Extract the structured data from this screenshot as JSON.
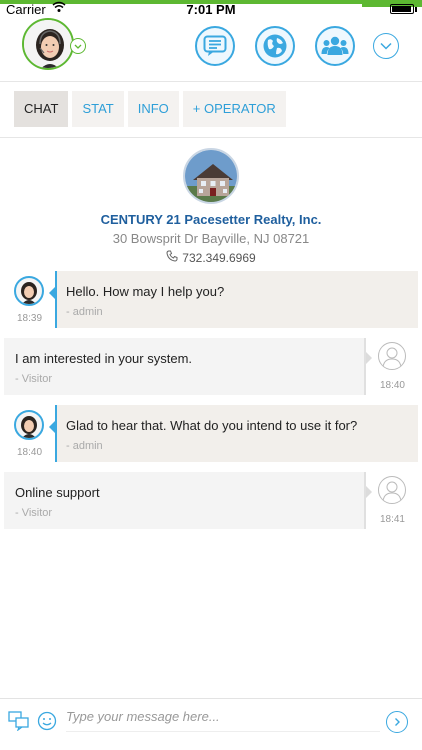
{
  "status_bar": {
    "carrier": "Carrier",
    "time": "7:01 PM",
    "battery_level": 0.95
  },
  "header": {
    "operator_avatar": "operator-avatar",
    "status_color": "#5db832",
    "accent_color": "#3aa8e0",
    "icons": [
      "chat-bubble-icon",
      "globe-icon",
      "group-icon",
      "chevron-down-icon"
    ]
  },
  "tabs": [
    {
      "label": "CHAT",
      "active": true
    },
    {
      "label": "STAT",
      "active": false
    },
    {
      "label": "INFO",
      "active": false
    },
    {
      "label": "+ OPERATOR",
      "active": false
    }
  ],
  "company": {
    "name": "CENTURY 21 Pacesetter Realty, Inc.",
    "address": "30 Bowsprit Dr Bayville, NJ 08721",
    "phone": "732.349.6969"
  },
  "messages": [
    {
      "role": "admin",
      "text": "Hello. How may I help you?",
      "author": "- admin",
      "time": "18:39"
    },
    {
      "role": "visitor",
      "text": "I am interested in your system.",
      "author": "- Visitor",
      "time": "18:40"
    },
    {
      "role": "admin",
      "text": "Glad to hear that. What do you intend to use it for?",
      "author": "- admin",
      "time": "18:40"
    },
    {
      "role": "visitor",
      "text": "Online support",
      "author": "- Visitor",
      "time": "18:41"
    }
  ],
  "composer": {
    "placeholder": "Type your message here..."
  }
}
